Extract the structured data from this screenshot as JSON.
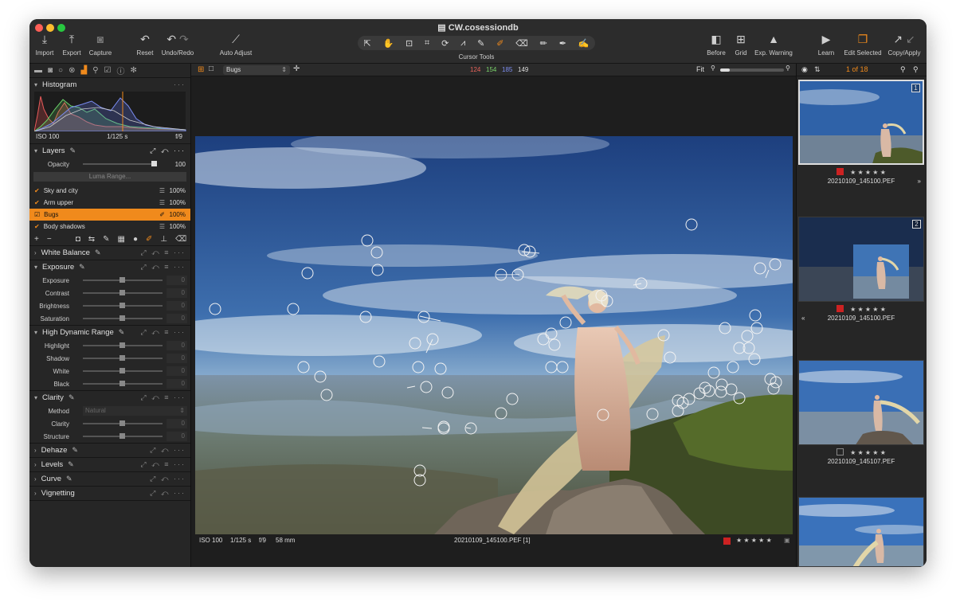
{
  "window": {
    "title": "CW.cosessiondb"
  },
  "toolbar": {
    "import": "Import",
    "export": "Export",
    "capture": "Capture",
    "reset": "Reset",
    "undo_redo": "Undo/Redo",
    "auto_adjust": "Auto Adjust",
    "cursor_tools": "Cursor Tools",
    "before": "Before",
    "grid": "Grid",
    "exp_warning": "Exp. Warning",
    "learn": "Learn",
    "edit_selected": "Edit Selected",
    "copy_apply": "Copy/Apply"
  },
  "histogram": {
    "title": "Histogram",
    "iso": "ISO 100",
    "shutter": "1/125 s",
    "aperture": "f/9"
  },
  "layers": {
    "title": "Layers",
    "opacity_label": "Opacity",
    "opacity_value": "100",
    "luma_range": "Luma Range...",
    "items": [
      {
        "name": "Sky and city",
        "pct": "100%"
      },
      {
        "name": "Arm upper",
        "pct": "100%"
      },
      {
        "name": "Bugs",
        "pct": "100%"
      },
      {
        "name": "Body shadows",
        "pct": "100%"
      }
    ],
    "selected": "Bugs"
  },
  "white_balance": {
    "title": "White Balance"
  },
  "exposure": {
    "title": "Exposure",
    "rows": [
      {
        "label": "Exposure",
        "value": "0"
      },
      {
        "label": "Contrast",
        "value": "0"
      },
      {
        "label": "Brightness",
        "value": "0"
      },
      {
        "label": "Saturation",
        "value": "0"
      }
    ]
  },
  "hdr": {
    "title": "High Dynamic Range",
    "rows": [
      {
        "label": "Highlight",
        "value": "0"
      },
      {
        "label": "Shadow",
        "value": "0"
      },
      {
        "label": "White",
        "value": "0"
      },
      {
        "label": "Black",
        "value": "0"
      }
    ]
  },
  "clarity": {
    "title": "Clarity",
    "method_label": "Method",
    "method_value": "Natural",
    "rows": [
      {
        "label": "Clarity",
        "value": "0"
      },
      {
        "label": "Structure",
        "value": "0"
      }
    ]
  },
  "collapsed": {
    "dehaze": "Dehaze",
    "levels": "Levels",
    "curve": "Curve",
    "vignetting": "Vignetting"
  },
  "viewer": {
    "layer_select": "Bugs",
    "r": "124",
    "g": "154",
    "b": "185",
    "l": "149",
    "fit": "Fit",
    "colors": {
      "r": "#e8625a",
      "g": "#7ad36a",
      "b": "#7c8df0"
    }
  },
  "image_info": {
    "iso": "ISO 100",
    "shutter": "1/125 s",
    "aperture": "f/9",
    "focal": "58 mm",
    "filename": "20210109_145100.PEF [1]"
  },
  "browser": {
    "count": "1 of 18",
    "thumbs": [
      {
        "num": "1",
        "name": "20210109_145100.PEF",
        "stars": "★ ★ ★ ★ ★",
        "label_color": "#cc2222"
      },
      {
        "num": "2",
        "name": "20210109_145100.PEF",
        "stars": "★ ★ ★ ★ ★",
        "label_color": "#cc2222"
      },
      {
        "num": "",
        "name": "20210109_145107.PEF",
        "stars": "★ ★ ★ ★ ★",
        "label_color": ""
      }
    ]
  },
  "accent": "#f08a1c"
}
